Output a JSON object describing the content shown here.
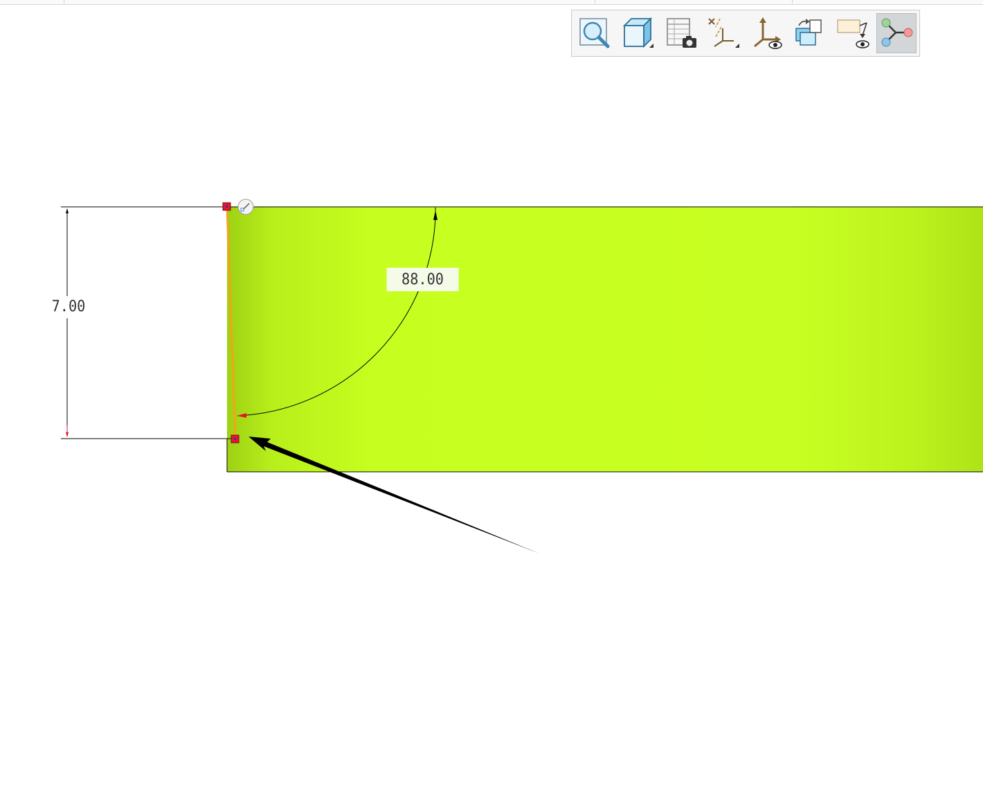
{
  "toolbar": {
    "buttons": [
      {
        "icon": "zoom-to-fit-icon"
      },
      {
        "icon": "display-style-icon"
      },
      {
        "icon": "saved-views-icon"
      },
      {
        "icon": "datum-display-icon"
      },
      {
        "icon": "csys-display-icon"
      },
      {
        "icon": "annotation-display-icon"
      },
      {
        "icon": "sketch-view-icon"
      },
      {
        "icon": "sketch-display-icon",
        "active": true
      }
    ]
  },
  "sketch": {
    "angle_dimension": "88.00",
    "height_dimension": "7.00",
    "colors": {
      "part_fill": "#c6ff1f",
      "part_fill_edge": "#9dd114",
      "selected_line": "#f7a21a",
      "handle": "#e5162b",
      "dimension_line": "#000000"
    }
  }
}
